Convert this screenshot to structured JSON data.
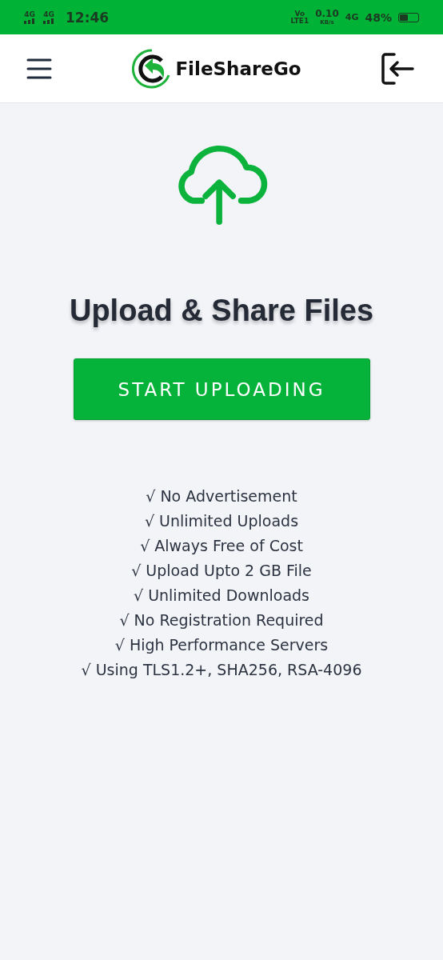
{
  "status_bar": {
    "left": [
      "4G",
      "4G"
    ],
    "time": "12:46",
    "volte": [
      "Vo",
      "LTE1"
    ],
    "speed": "0.10",
    "speed_unit": "KB/s",
    "network": "4G",
    "battery": "48%"
  },
  "header": {
    "brand": "FileShareGo"
  },
  "hero": {
    "title": "Upload & Share Files",
    "button": "START UPLOADING"
  },
  "features": [
    "√ No Advertisement",
    "√ Unlimited Uploads",
    "√ Always Free of Cost",
    "√ Upload Upto 2 GB File",
    "√ Unlimited Downloads",
    "√ No Registration Required",
    "√ High Performance Servers",
    "√ Using TLS1.2+, SHA256, RSA-4096"
  ]
}
